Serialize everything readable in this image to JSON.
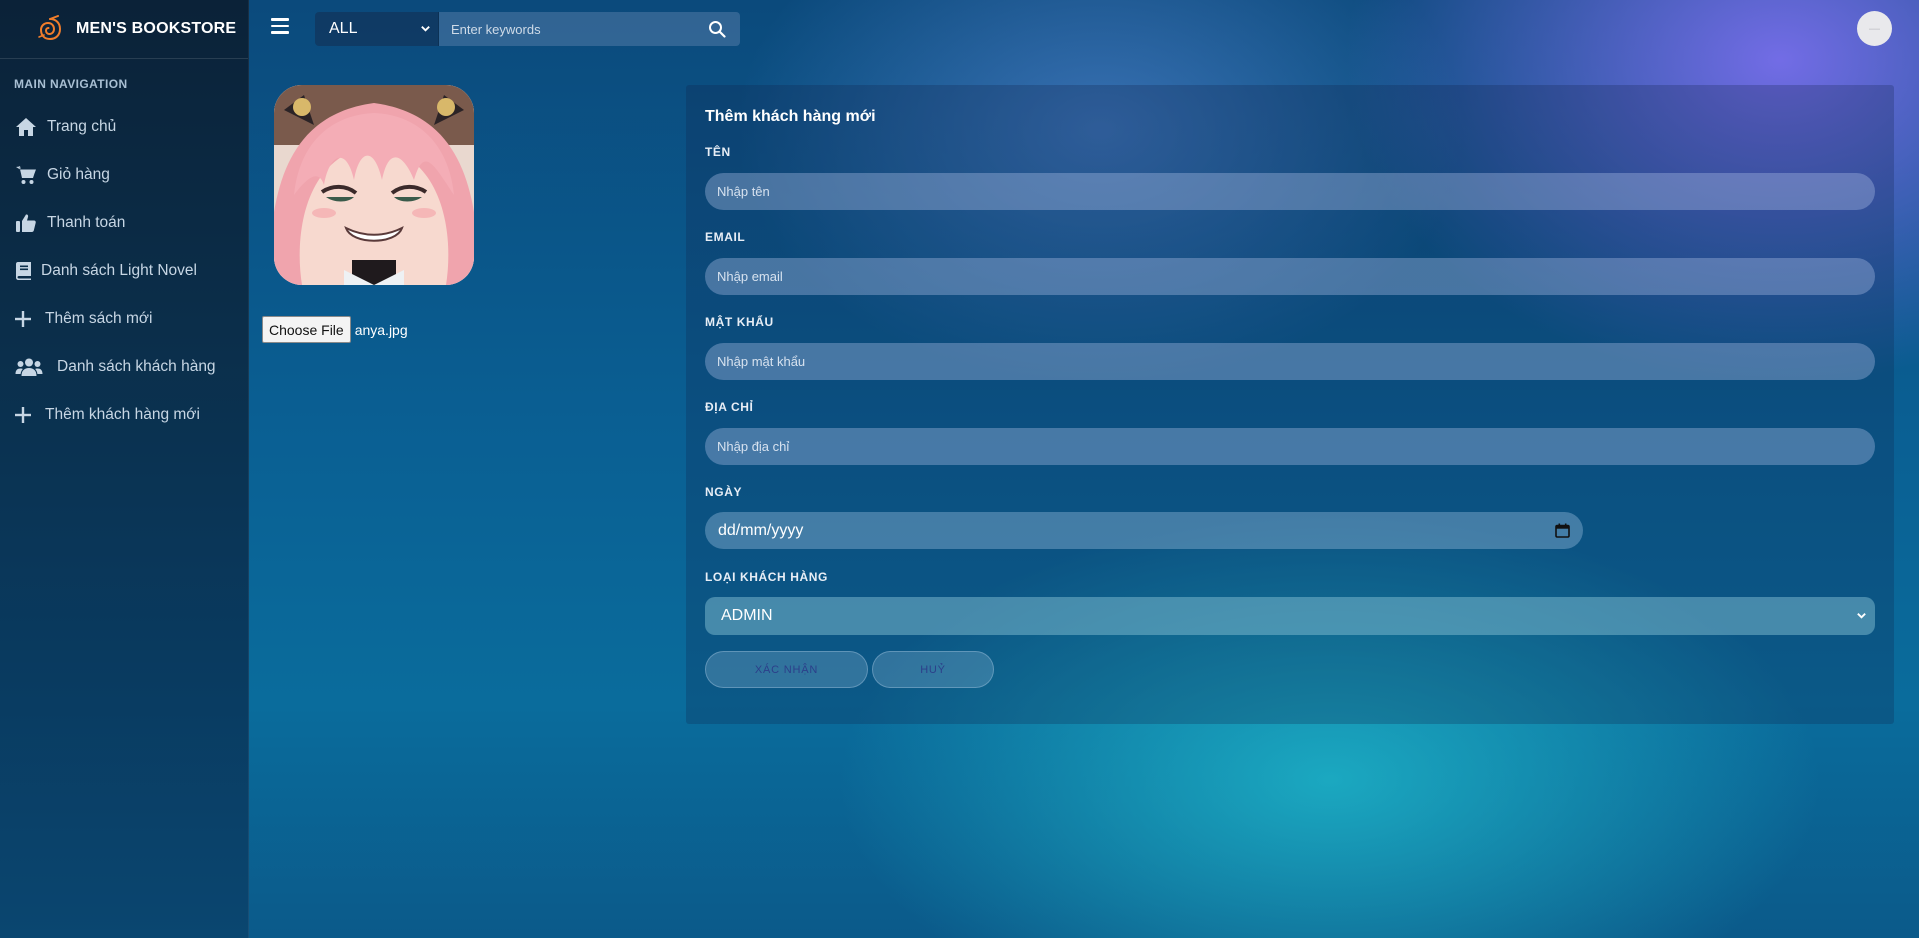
{
  "brand": {
    "name": "MEN'S BOOKSTORE",
    "logo_icon": "swirl-logo-icon",
    "logo_color": "#f07d2b"
  },
  "sidebar": {
    "header": "MAIN NAVIGATION",
    "items": [
      {
        "label": "Trang chủ",
        "icon": "home-icon"
      },
      {
        "label": "Giỏ hàng",
        "icon": "cart-icon"
      },
      {
        "label": "Thanh toán",
        "icon": "thumbs-up-icon"
      },
      {
        "label": "Danh sách Light Novel",
        "icon": "book-icon"
      },
      {
        "label": "Thêm sách mới",
        "icon": "plus-icon"
      },
      {
        "label": "Danh sách khách hàng",
        "icon": "users-icon"
      },
      {
        "label": "Thêm khách hàng mới",
        "icon": "plus-icon"
      }
    ]
  },
  "topbar": {
    "category": "ALL",
    "search_placeholder": "Enter keywords"
  },
  "upload": {
    "button_label": "Choose File",
    "file_name": "anya.jpg"
  },
  "form": {
    "title": "Thêm khách hàng mới",
    "name": {
      "label": "TÊN",
      "placeholder": "Nhập tên"
    },
    "email": {
      "label": "EMAIL",
      "placeholder": "Nhập email"
    },
    "password": {
      "label": "MẬT KHẨU",
      "placeholder": "Nhập mật khẩu"
    },
    "address": {
      "label": "ĐỊA CHỈ",
      "placeholder": "Nhập địa chỉ"
    },
    "date": {
      "label": "NGÀY",
      "value": "dd/mm/yyyy"
    },
    "customer_type": {
      "label": "LOẠI KHÁCH HÀNG",
      "value": "ADMIN"
    },
    "confirm_label": "XÁC NHẬN",
    "cancel_label": "HUỶ"
  }
}
